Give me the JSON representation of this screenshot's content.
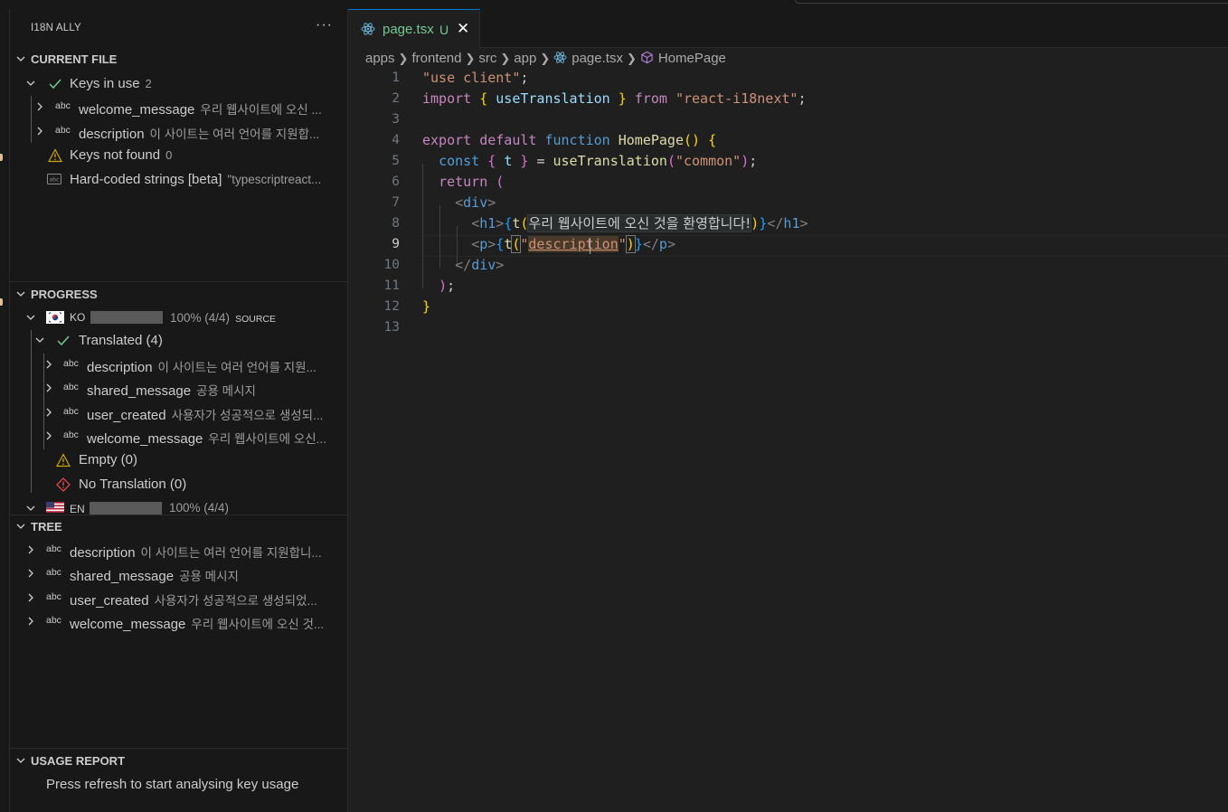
{
  "sidebar": {
    "title": "I18N ALLY",
    "more_label": "···",
    "current_file": {
      "header": "CURRENT FILE",
      "keys_in_use": {
        "label": "Keys in use",
        "count": "2"
      },
      "keys": [
        {
          "key": "welcome_message",
          "value": "우리 웹사이트에 오신 ..."
        },
        {
          "key": "description",
          "value": "이 사이트는 여러 언어를 지원합..."
        }
      ],
      "keys_not_found": {
        "label": "Keys not found",
        "count": "0"
      },
      "hardcoded": {
        "label": "Hard-coded strings [beta]",
        "value": "\"typescriptreact..."
      }
    },
    "progress": {
      "header": "PROGRESS",
      "locales": [
        {
          "code": "KO",
          "percent": "100%",
          "ratio": "(4/4)",
          "tag": "SOURCE",
          "progress": 1.0
        },
        {
          "code": "EN",
          "percent": "100%",
          "ratio": "(4/4)",
          "tag": "",
          "progress": 1.0
        }
      ],
      "translated_label": "Translated (4)",
      "translated_items": [
        {
          "key": "description",
          "value": "이 사이트는 여러 언어를 지원..."
        },
        {
          "key": "shared_message",
          "value": "공용 메시지"
        },
        {
          "key": "user_created",
          "value": "사용자가 성공적으로 생성되..."
        },
        {
          "key": "welcome_message",
          "value": "우리 웹사이트에 오신..."
        }
      ],
      "empty_label": "Empty (0)",
      "no_translation_label": "No Translation (0)"
    },
    "tree": {
      "header": "TREE",
      "items": [
        {
          "key": "description",
          "value": "이 사이트는 여러 언어를 지원합니..."
        },
        {
          "key": "shared_message",
          "value": "공용 메시지"
        },
        {
          "key": "user_created",
          "value": "사용자가 성공적으로 생성되었..."
        },
        {
          "key": "welcome_message",
          "value": "우리 웹사이트에 오신 것..."
        }
      ]
    },
    "usage_report": {
      "header": "USAGE REPORT",
      "message": "Press refresh to start analysing key usage"
    },
    "abc_label": "abc"
  },
  "editor": {
    "tab": {
      "name": "page.tsx",
      "status": "U",
      "close": "✕"
    },
    "breadcrumbs": [
      "apps",
      "frontend",
      "src",
      "app",
      "page.tsx",
      "HomePage"
    ],
    "breadcrumb_sep": "❯",
    "line_numbers": [
      "1",
      "2",
      "3",
      "4",
      "5",
      "6",
      "7",
      "8",
      "9",
      "10",
      "11",
      "12",
      "13"
    ],
    "active_line": "9",
    "code": {
      "l1": "\"use client\"",
      "l1_end": ";",
      "l2_import": "import",
      "l2_ident": "useTranslation",
      "l2_from": "from",
      "l2_str": "\"react-i18next\"",
      "l4_export": "export",
      "l4_default": "default",
      "l4_function": "function",
      "l4_name": "HomePage",
      "l5_const": "const",
      "l5_t": "t",
      "l5_call": "useTranslation",
      "l5_arg": "\"common\"",
      "l6_return": "return",
      "tag_div": "div",
      "tag_h1": "h1",
      "tag_p": "p",
      "l8_inlay": "우리 웹사이트에 오신 것을 환영합니다!",
      "l9_key": "description"
    }
  },
  "colors": {
    "accent": "#0078d4",
    "untracked": "#73c991",
    "warning": "#cca700",
    "error": "#f14c4c",
    "check": "#73c991"
  }
}
